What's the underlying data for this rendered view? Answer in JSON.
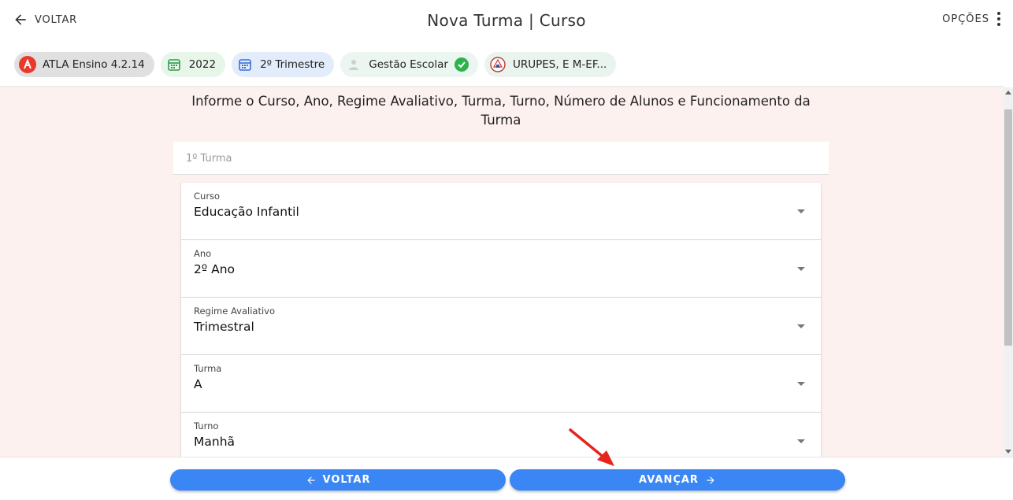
{
  "header": {
    "back_label": "VOLTAR",
    "title": "Nova Turma | Curso",
    "options_label": "OPÇÕES"
  },
  "chips": [
    {
      "label": "ATLA Ensino 4.2.14",
      "icon": "atla-logo-icon"
    },
    {
      "label": "2022",
      "icon": "calendar-icon"
    },
    {
      "label": "2º Trimestre",
      "icon": "calendar-icon"
    },
    {
      "label": "Gestão Escolar",
      "icon": "person-icon",
      "status_icon": "check-circle-icon"
    },
    {
      "label": "URUPES, E M-EF...",
      "icon": "school-crest-icon"
    }
  ],
  "main": {
    "instructions": "Informe o Curso, Ano, Regime Avaliativo, Turma, Turno, Número de Alunos e Funcionamento da Turma",
    "turma_header": "1º Turma",
    "fields": [
      {
        "label": "Curso",
        "value": "Educação Infantil"
      },
      {
        "label": "Ano",
        "value": "2º Ano"
      },
      {
        "label": "Regime Avaliativo",
        "value": "Trimestral"
      },
      {
        "label": "Turma",
        "value": "A"
      },
      {
        "label": "Turno",
        "value": "Manhã"
      }
    ]
  },
  "footer": {
    "back_button": "VOLTAR",
    "next_button": "AVANÇAR"
  },
  "colors": {
    "primary": "#3a86f5",
    "background_tint": "#fdf1f0",
    "success": "#2fb14c",
    "annotation_arrow": "#e8231c"
  }
}
